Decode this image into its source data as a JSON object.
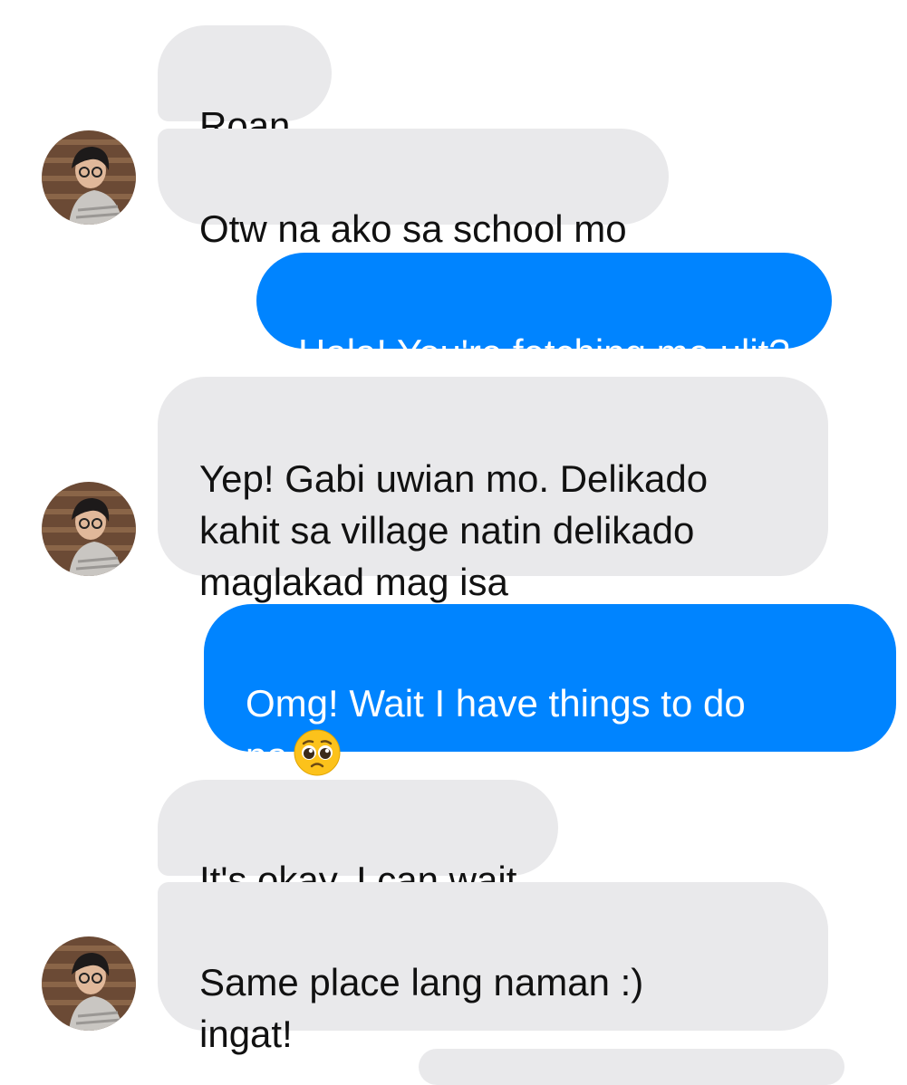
{
  "conversation": {
    "messages": [
      {
        "sender": "them",
        "text": "Roan"
      },
      {
        "sender": "them",
        "text": "Otw na ako sa school mo"
      },
      {
        "sender": "me",
        "text": "Hala! You're fetching me ulit?"
      },
      {
        "sender": "them",
        "text": "Yep! Gabi uwian mo. Delikado\nkahit sa village natin delikado\nmaglakad mag isa"
      },
      {
        "sender": "me",
        "text": "Omg! Wait I have things to do\npa"
      },
      {
        "sender": "them",
        "text": "It's okay. I can wait"
      },
      {
        "sender": "them",
        "text": "Same place lang naman :)\ningat!"
      }
    ],
    "emojis": {
      "pleading_face": "pleading-face-icon"
    },
    "avatar_icon": "profile-photo-avatar"
  },
  "colors": {
    "outgoing_bubble": "#0084ff",
    "incoming_bubble": "#e9e9eb",
    "outgoing_text": "#ffffff",
    "incoming_text": "#111111"
  }
}
